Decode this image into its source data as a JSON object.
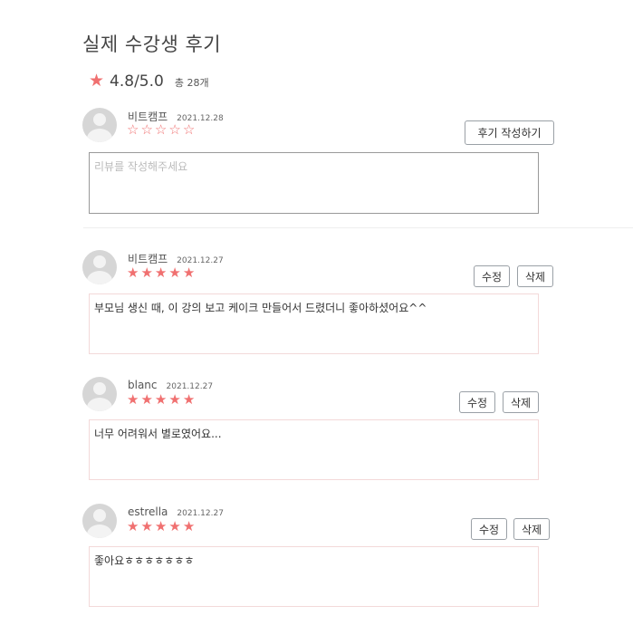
{
  "title": "실제 수강생 후기",
  "summary": {
    "score": "4.8/5.0",
    "total": "총 28개",
    "star_color": "#f07070"
  },
  "compose": {
    "username": "비트캠프",
    "date": "2021.12.28",
    "rating": 0,
    "submit_label": "후기 작성하기",
    "placeholder": "리뷰를 작성해주세요"
  },
  "reviews": [
    {
      "username": "비트캠프",
      "date": "2021.12.27",
      "rating": 5,
      "content": "부모님 생신 때, 이 강의 보고 케이크 만들어서 드렸더니 좋아하셨어요^^",
      "edit_label": "수정",
      "delete_label": "삭제"
    },
    {
      "username": "blanc",
      "date": "2021.12.27",
      "rating": 5,
      "content": "너무 어려워서 별로였어요...",
      "edit_label": "수정",
      "delete_label": "삭제"
    },
    {
      "username": "estrella",
      "date": "2021.12.27",
      "rating": 5,
      "content": "좋아요ㅎㅎㅎㅎㅎㅎㅎ",
      "edit_label": "수정",
      "delete_label": "삭제"
    }
  ]
}
